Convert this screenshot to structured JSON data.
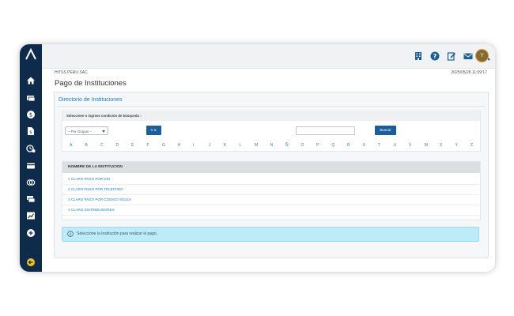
{
  "sidebar": {
    "items": [
      {
        "icon": "home-icon"
      },
      {
        "icon": "card-icon"
      },
      {
        "icon": "dollar-icon"
      },
      {
        "icon": "document-dollar-icon"
      },
      {
        "icon": "clock-dollar-icon"
      },
      {
        "icon": "payment-card-icon"
      },
      {
        "icon": "toggle-icon"
      },
      {
        "icon": "transfer-icon"
      },
      {
        "icon": "chart-icon"
      },
      {
        "icon": "plus-circle-icon"
      },
      {
        "icon": "logout-icon"
      }
    ]
  },
  "header": {
    "company": "HITSS PERU SAC",
    "datetime": "2025/05/28 11:09:17",
    "avatar_initial": "Y"
  },
  "page": {
    "title": "Pago de Instituciones"
  },
  "directory": {
    "title": "Directorio de Instituciones",
    "search_label": "Seleccione o ingrese condición de búsqueda :",
    "select_value": "-- Por Grupos --",
    "go_button": "Ir a:",
    "search_button": "Buscar",
    "letters": [
      "A",
      "B",
      "C",
      "D",
      "E",
      "F",
      "G",
      "H",
      "I",
      "J",
      "K",
      "L",
      "M",
      "N",
      "Ñ",
      "O",
      "P",
      "Q",
      "R",
      "S",
      "T",
      "U",
      "V",
      "W",
      "X",
      "Y",
      "Z"
    ]
  },
  "table": {
    "header": "NOMBRE DE LA INSTITUCION",
    "rows": [
      "1 CLARO PAGO POR DNI",
      "2 CLARO PAGO POR TELEFONO",
      "3 CLARO PAGO POR CODIGO SOLES",
      "4 CLARO DISTRIBUIDORES"
    ]
  },
  "alert": {
    "text": "Seleccione la Institución para realizar el pago."
  },
  "colors": {
    "sidebar": "#0f2b4b",
    "accent": "#1c5e9b",
    "link": "#1a86c9",
    "alert_bg": "#bdebf7"
  }
}
